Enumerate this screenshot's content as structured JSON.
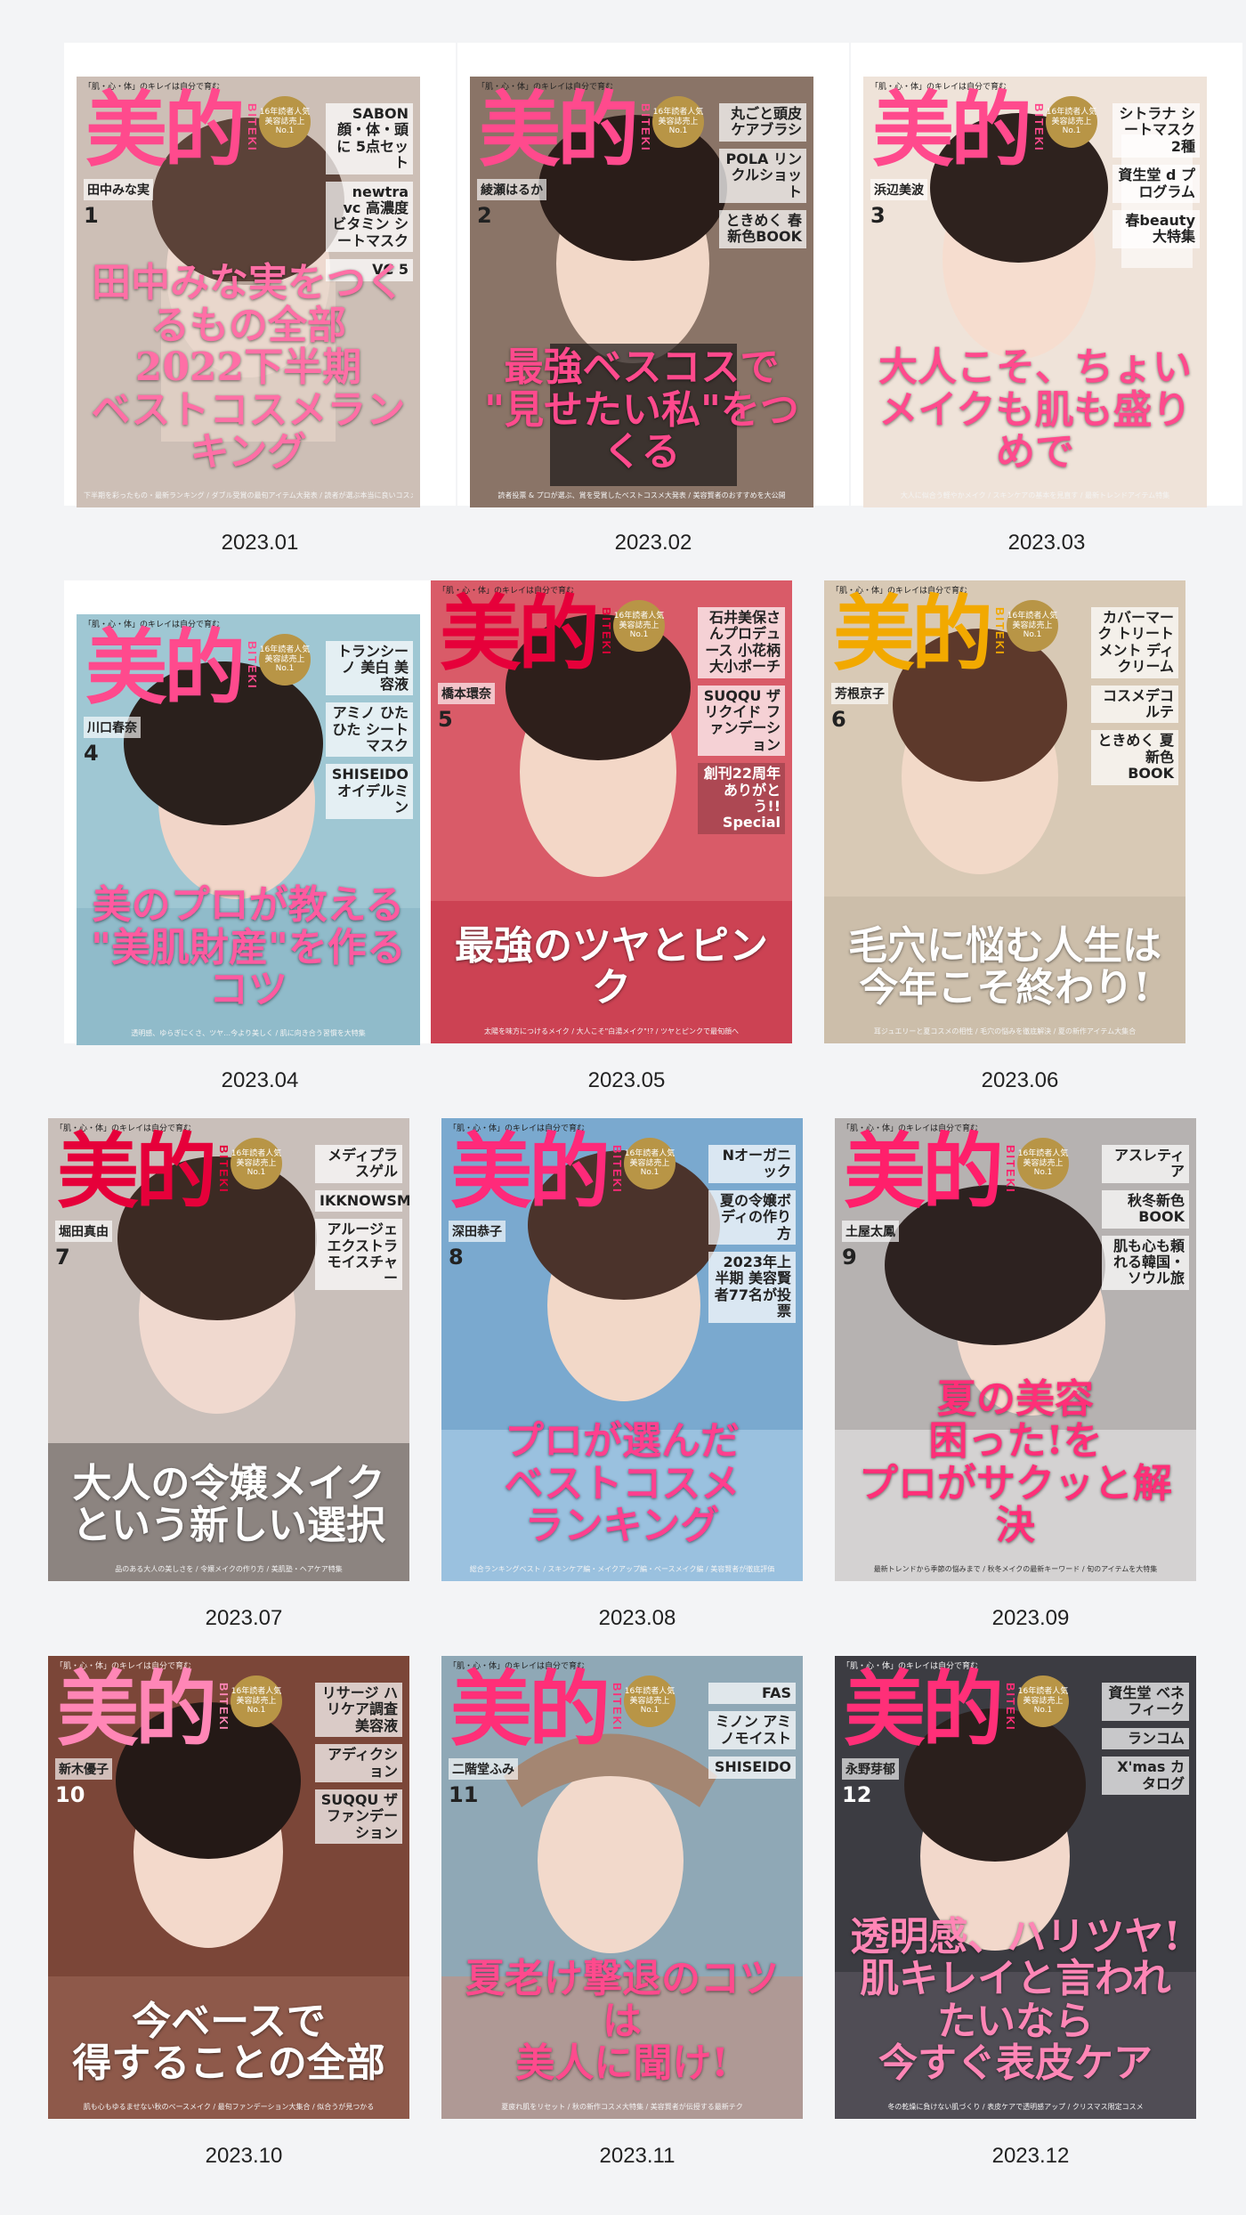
{
  "gallery": {
    "items": [
      {
        "caption": "2023.01",
        "cover_bg": "#cdbfb6",
        "logo_color": "#ff4a8d",
        "headline_color": "#ff6fa6",
        "cover": {
          "top_strip": "「肌・心・体」のキレイは自分で育む",
          "logo": "美的",
          "logo_sub": "BITEKI",
          "badge": "16年読者人気 美容誌売上 No.1",
          "star": "田中みな実",
          "issue": "1",
          "side_1": "SABON 顔・体・頭に 5点セット",
          "side_2": "newtra vc 高濃度ビタミン シートマスク",
          "side_3": "VC 5",
          "headline": "田中みな実をつくるもの全部\n2022下半期\nベストコスメランキング",
          "footer": "下半期を彩ったもの・最新ランキング / ダブル受賞の最旬アイテム大発表 / 読者が選ぶ本当に良いコスメ"
        }
      },
      {
        "caption": "2023.02",
        "cover_bg": "#8a7467",
        "logo_color": "#ff4a8d",
        "headline_color": "#ff4a8d",
        "cover": {
          "top_strip": "「肌・心・体」のキレイは自分で育む",
          "logo": "美的",
          "logo_sub": "BITEKI",
          "badge": "16年読者人気 美容誌売上 No.1",
          "star": "綾瀬はるか",
          "issue": "2",
          "side_1": "丸ごと頭皮 ケアブラシ",
          "side_2": "POLA リンクルショット",
          "side_3": "ときめく 春新色BOOK",
          "headline": "最強ベスコスで\n\"見せたい私\"をつくる",
          "footer": "読者投票 & プロが選ぶ、賞を受賞したベストコスメ大発表 / 美容賢者のおすすめを大公開"
        }
      },
      {
        "caption": "2023.03",
        "cover_bg": "#efe3d9",
        "logo_color": "#ff4a8d",
        "headline_color": "#ff4a8d",
        "cover": {
          "top_strip": "「肌・心・体」のキレイは自分で育む",
          "logo": "美的",
          "logo_sub": "BITEKI",
          "badge": "16年読者人気 美容誌売上 No.1",
          "star": "浜辺美波",
          "issue": "3",
          "side_1": "シトラナ シートマスク 2種",
          "side_2": "資生堂 d プログラム",
          "side_3": "春beauty大特集",
          "headline": "大人こそ、ちょい\nメイクも肌も盛りめで",
          "footer": "大人に似合う軽やかメイク / スキンケアの基本を見直す / 最新トレンドアイテム特集"
        }
      },
      {
        "caption": "2023.04",
        "cover_bg": "#9fc7d3",
        "logo_color": "#ff4a8d",
        "headline_color": "#ff5aa0",
        "cover": {
          "top_strip": "「肌・心・体」のキレイは自分で育む",
          "logo": "美的",
          "logo_sub": "BITEKI",
          "badge": "16年読者人気 美容誌売上 No.1",
          "star": "川口春奈",
          "issue": "4",
          "side_1": "トランシーノ 美白 美容液",
          "side_2": "アミノ ひたひた シートマスク",
          "side_3": "SHISEIDO オイデルミン",
          "headline": "美のプロが教える\n\"美肌財産\"を作るコツ",
          "footer": "透明感、ゆらぎにくさ、ツヤ…今より美しく / 肌に向き合う習慣を大特集"
        }
      },
      {
        "caption": "2023.05",
        "cover_bg": "#d95b68",
        "logo_color": "#e6003a",
        "headline_color": "#ffffff",
        "cover": {
          "top_strip": "「肌・心・体」のキレイは自分で育む",
          "logo": "美的",
          "logo_sub": "BITEKI",
          "badge": "16年読者人気 美容誌売上 No.1",
          "star": "橋本環奈",
          "issue": "5",
          "side_1": "石井美保さんプロデュース 小花柄 大小ポーチ",
          "side_2": "SUQQU ザ リクイド ファンデーション",
          "side_3": "創刊22周年 ありがとう!! Special",
          "headline": "最強のツヤとピンク",
          "footer": "太陽を味方につけるメイク / 大人こそ\"白湯メイク\"!? / ツヤとピンクで最旬顔へ"
        }
      },
      {
        "caption": "2023.06",
        "cover_bg": "#d8c9b5",
        "logo_color": "#f2a900",
        "headline_color": "#ffffff",
        "cover": {
          "top_strip": "「肌・心・体」のキレイは自分で育む",
          "logo": "美的",
          "logo_sub": "BITEKI",
          "badge": "16年読者人気 美容誌売上 No.1",
          "star": "芳根京子",
          "issue": "6",
          "side_1": "カバーマーク トリートメント ディクリーム",
          "side_2": "コスメデコルテ",
          "side_3": "ときめく 夏新色 BOOK",
          "headline": "毛穴に悩む人生は\n今年こそ終わり!",
          "footer": "耳ジュエリーと夏コスメの相性 / 毛穴の悩みを徹底解決 / 夏の新作アイテム大集合"
        }
      },
      {
        "caption": "2023.07",
        "cover_bg": "#c9bfba",
        "logo_color": "#e6003a",
        "headline_color": "#ffffff",
        "cover": {
          "top_strip": "「肌・心・体」のキレイは自分で育む",
          "logo": "美的",
          "logo_sub": "BITEKI",
          "badge": "16年読者人気 美容誌売上 No.1",
          "star": "堀田真由",
          "issue": "7",
          "side_1": "メディプラスゲル",
          "side_2": "IKKNOWSMOI",
          "side_3": "アルージェ エクストラモイスチャー",
          "headline": "大人の令嬢メイク\nという新しい選択",
          "footer": "品のある大人の美しさを / 令嬢メイクの作り方 / 美肌塾・ヘアケア特集"
        }
      },
      {
        "caption": "2023.08",
        "cover_bg": "#7aa9cf",
        "logo_color": "#ff2a7a",
        "headline_color": "#ff3f8e",
        "cover": {
          "top_strip": "「肌・心・体」のキレイは自分で育む",
          "logo": "美的",
          "logo_sub": "BITEKI",
          "badge": "16年読者人気 美容誌売上 No.1",
          "star": "深田恭子",
          "issue": "8",
          "side_1": "Nオーガニック",
          "side_2": "夏の令嬢ボディの作り方",
          "side_3": "2023年上半期 美容賢者77名が投票",
          "headline": "プロが選んだ\nベストコスメ\nランキング",
          "footer": "総合ランキングベスト / スキンケア編・メイクアップ編・ベースメイク編 / 美容賢者が徹底評価"
        }
      },
      {
        "caption": "2023.09",
        "cover_bg": "#b6b2b1",
        "logo_color": "#ff1f6b",
        "headline_color": "#ff2f78",
        "cover": {
          "top_strip": "「肌・心・体」のキレイは自分で育む",
          "logo": "美的",
          "logo_sub": "BITEKI",
          "badge": "16年読者人気 美容誌売上 No.1",
          "star": "土屋太鳳",
          "issue": "9",
          "side_1": "アスレティア",
          "side_2": "秋冬新色 BOOK",
          "side_3": "肌も心も頼れる韓国・ソウル旅",
          "headline": "夏の美容\n困った!を\nプロがサクッと解決",
          "footer": "最新トレンドから季節の悩みまで / 秋冬メイクの最新キーワード / 旬のアイテムを大特集"
        }
      },
      {
        "caption": "2023.10",
        "cover_bg": "#7b4638",
        "logo_color": "#ff86b6",
        "headline_color": "#ffffff",
        "cover": {
          "top_strip": "「肌・心・体」のキレイは自分で育む",
          "logo": "美的",
          "logo_sub": "BITEKI",
          "badge": "16年読者人気 美容誌売上 No.1",
          "star": "新木優子",
          "issue": "10",
          "side_1": "リサージ ハリケア調査美容液",
          "side_2": "アディクション",
          "side_3": "SUQQU ザ ファンデーション",
          "headline": "今ベースで\n得することの全部",
          "footer": "肌も心もゆるませない秋のベースメイク / 最旬ファンデーション大集合 / 似合うが見つかる"
        }
      },
      {
        "caption": "2023.11",
        "cover_bg": "#8fa8b6",
        "logo_color": "#ff2f78",
        "headline_color": "#ff4a8d",
        "cover": {
          "top_strip": "「肌・心・体」のキレイは自分で育む",
          "logo": "美的",
          "logo_sub": "BITEKI",
          "badge": "16年読者人気 美容誌売上 No.1",
          "star": "二階堂ふみ",
          "issue": "11",
          "side_1": "FAS",
          "side_2": "ミノン アミノモイスト",
          "side_3": "SHISEIDO",
          "headline": "夏老け撃退のコツは\n美人に聞け!",
          "footer": "夏疲れ肌をリセット / 秋の新作コスメ大特集 / 美容賢者が伝授する最新テク"
        }
      },
      {
        "caption": "2023.12",
        "cover_bg": "#3c3c42",
        "logo_color": "#ff2f78",
        "headline_color": "#ff86b6",
        "cover": {
          "top_strip": "「肌・心・体」のキレイは自分で育む",
          "logo": "美的",
          "logo_sub": "BITEKI",
          "badge": "16年読者人気 美容誌売上 No.1",
          "star": "永野芽郁",
          "issue": "12",
          "side_1": "資生堂 ベネフィーク",
          "side_2": "ランコム",
          "side_3": "X'mas カタログ",
          "headline": "透明感、ハリツヤ!\n肌キレイと言われたいなら\n今すぐ表皮ケア",
          "footer": "冬の乾燥に負けない肌づくり / 表皮ケアで透明感アップ / クリスマス限定コスメ"
        }
      }
    ]
  }
}
